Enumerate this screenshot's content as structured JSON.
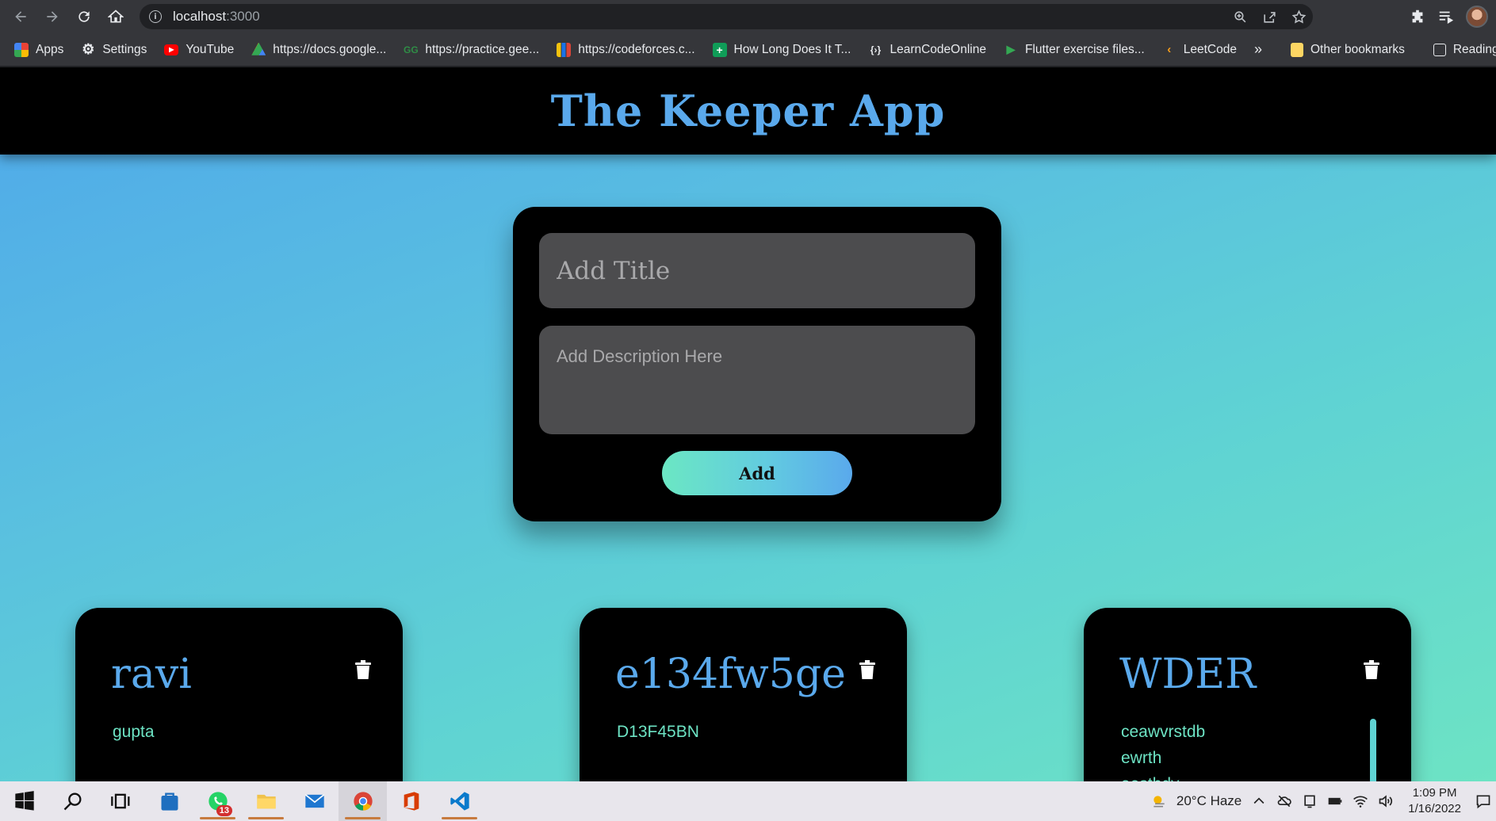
{
  "browser": {
    "url_host": "localhost",
    "url_port": ":3000",
    "bookmarks": [
      {
        "label": "Apps",
        "icon": "apps-grid-icon"
      },
      {
        "label": "Settings",
        "icon": "gear-icon"
      },
      {
        "label": "YouTube",
        "icon": "youtube-icon"
      },
      {
        "label": "https://docs.google...",
        "icon": "google-drive-icon"
      },
      {
        "label": "https://practice.gee...",
        "icon": "geeksforgeeks-icon"
      },
      {
        "label": "https://codeforces.c...",
        "icon": "codeforces-icon"
      },
      {
        "label": "How Long Does It T...",
        "icon": "green-plus-icon"
      },
      {
        "label": "LearnCodeOnline",
        "icon": "learncodeonline-icon"
      },
      {
        "label": "Flutter exercise files...",
        "icon": "play-icon"
      },
      {
        "label": "LeetCode",
        "icon": "leetcode-icon"
      }
    ],
    "more": "»",
    "other_bookmarks": "Other bookmarks",
    "reading_list": "Reading l"
  },
  "app": {
    "title": "The Keeper App",
    "form": {
      "title_placeholder": "Add Title",
      "description_placeholder": "Add Description Here",
      "add_label": "Add"
    },
    "notes": [
      {
        "title": "ravi",
        "body": "gupta"
      },
      {
        "title": "e134fw5ge",
        "body": "D13F45BN"
      },
      {
        "title": "WDER",
        "body": "ceawvrstdb\newrth\naesthdy"
      }
    ]
  },
  "taskbar": {
    "whatsapp_badge": "13",
    "weather": "20°C  Haze",
    "time": "1:09 PM",
    "date": "1/16/2022"
  },
  "colors": {
    "accent_blue": "#5aa9ec",
    "accent_teal": "#6de3c4",
    "card_bg": "#000000",
    "input_bg": "#4c4c4e"
  }
}
